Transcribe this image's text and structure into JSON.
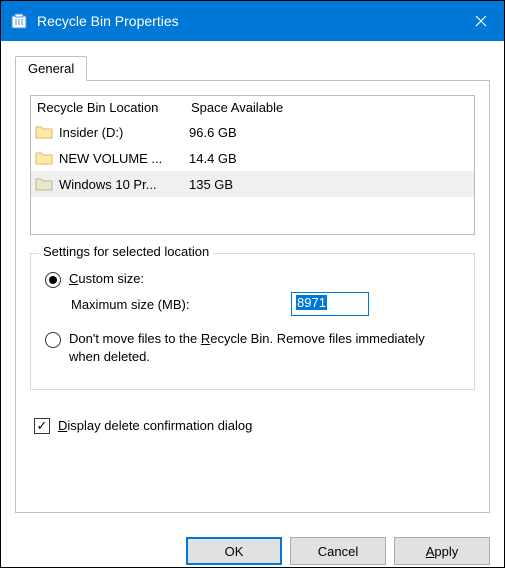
{
  "window": {
    "title": "Recycle Bin Properties"
  },
  "tabs": {
    "general": "General"
  },
  "list": {
    "headers": {
      "col1": "Recycle Bin Location",
      "col2": "Space Available"
    },
    "rows": [
      {
        "name": "Insider (D:)",
        "space": "96.6 GB",
        "selected": false
      },
      {
        "name": "NEW VOLUME ...",
        "space": "14.4 GB",
        "selected": false
      },
      {
        "name": "Windows 10 Pr...",
        "space": "135 GB",
        "selected": true
      }
    ]
  },
  "settings": {
    "legend": "Settings for selected location",
    "custom": {
      "prefix": "C",
      "rest": "ustom size:"
    },
    "maxsize_label": "Maximum size (MB):",
    "maxsize_value": "8971",
    "dontmove": {
      "p1": "Don't move files to the ",
      "u": "R",
      "p2": "ecycle Bin. Remove files immediately when deleted."
    }
  },
  "confirm": {
    "u": "D",
    "rest": "isplay delete confirmation dialog"
  },
  "buttons": {
    "ok": "OK",
    "cancel": "Cancel",
    "apply": {
      "u": "A",
      "rest": "pply"
    }
  }
}
